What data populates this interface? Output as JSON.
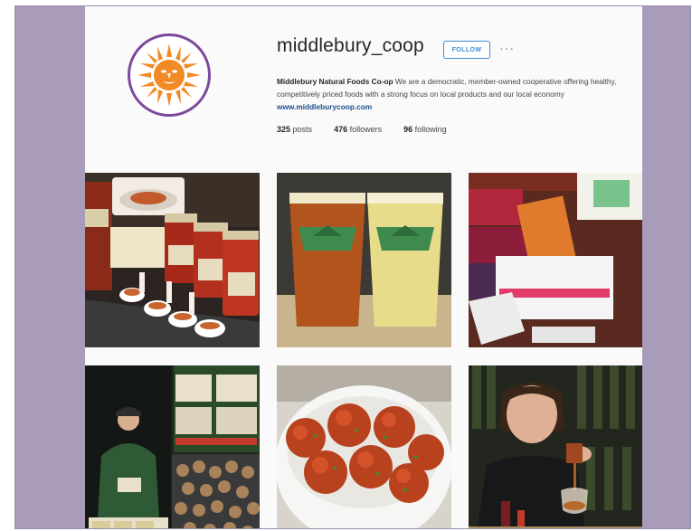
{
  "profile": {
    "username": "middlebury_coop",
    "follow_label": "FOLLOW",
    "more_label": "···",
    "bio_name": "Middlebury Natural Foods Co-op",
    "bio_text": " We are a democratic, member-owned cooperative offering healthy, competitively priced foods with a strong focus on local products and our local economy ",
    "bio_link": "www.middleburycoop.com",
    "stats": {
      "posts_count": "325",
      "posts_label": "posts",
      "followers_count": "476",
      "followers_label": "followers",
      "following_count": "96",
      "following_label": "following"
    }
  },
  "posts": [
    {
      "subject": "pasta-sauce-jars-tasting"
    },
    {
      "subject": "two-pints-of-beer"
    },
    {
      "subject": "boomchickapop-display"
    },
    {
      "subject": "staff-member-with-frozen-products"
    },
    {
      "subject": "meatballs-bowl"
    },
    {
      "subject": "woman-pouring-drink"
    }
  ],
  "colors": {
    "frame": "#a89cba",
    "avatar_ring": "#7b4a9c",
    "sun_orange": "#f28a25",
    "follow_blue": "#3d8cd6",
    "link_blue": "#1b4f8a"
  },
  "icons": {
    "avatar": "sun-logo-icon",
    "more": "ellipsis-icon"
  }
}
